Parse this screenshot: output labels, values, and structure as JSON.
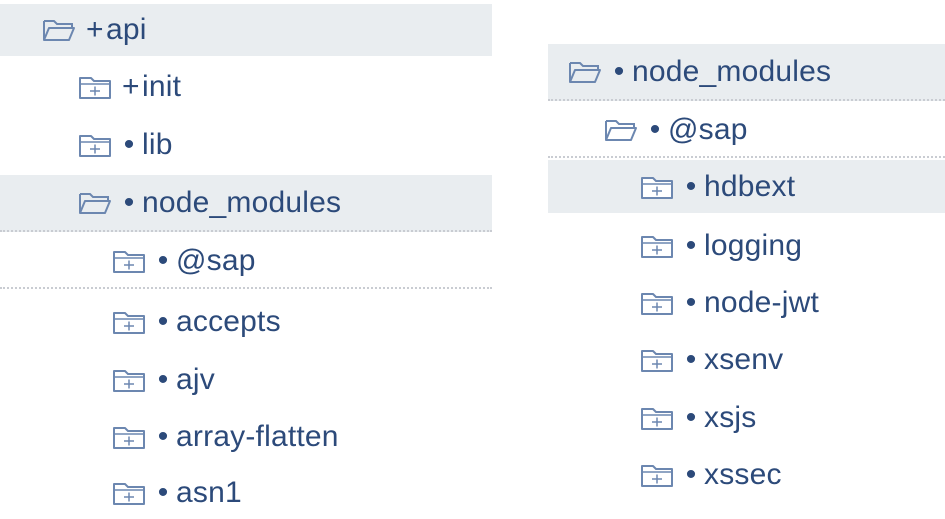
{
  "left_tree": {
    "items": [
      {
        "prefix": "+",
        "label": "api"
      },
      {
        "prefix": "+",
        "label": "init"
      },
      {
        "prefix": "•",
        "label": "lib"
      },
      {
        "prefix": "•",
        "label": "node_modules"
      },
      {
        "prefix": "•",
        "label": "@sap"
      },
      {
        "prefix": "•",
        "label": "accepts"
      },
      {
        "prefix": "•",
        "label": "ajv"
      },
      {
        "prefix": "•",
        "label": "array-flatten"
      },
      {
        "prefix": "•",
        "label": "asn1"
      }
    ]
  },
  "right_tree": {
    "items": [
      {
        "prefix": "•",
        "label": "node_modules"
      },
      {
        "prefix": "•",
        "label": "@sap"
      },
      {
        "prefix": "•",
        "label": "hdbext"
      },
      {
        "prefix": "•",
        "label": "logging"
      },
      {
        "prefix": "•",
        "label": "node-jwt"
      },
      {
        "prefix": "•",
        "label": "xsenv"
      },
      {
        "prefix": "•",
        "label": "xsjs"
      },
      {
        "prefix": "•",
        "label": "xssec"
      }
    ]
  },
  "icons": {
    "open": "folder-open-icon",
    "closed": "folder-closed-plus-icon"
  },
  "colors": {
    "text": "#2c4a7a",
    "icon_stroke": "#6c87b0",
    "selected_bg": "#e9edf0",
    "separator": "#c9ccd2"
  }
}
